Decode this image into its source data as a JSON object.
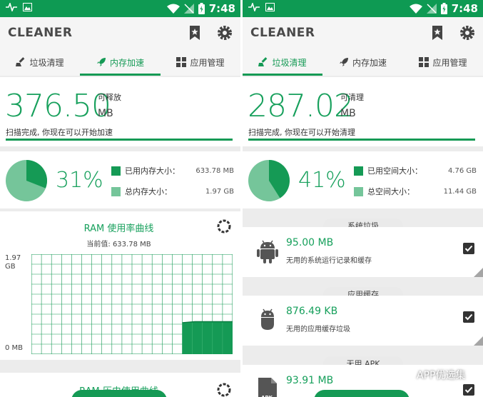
{
  "colors": {
    "brand": "#159a55",
    "status_bar": "#0e9a53",
    "pie_light": "#75c59a",
    "pie_dark": "#159a55"
  },
  "status_bar": {
    "time": "7:48"
  },
  "app": {
    "title": "CLEANER"
  },
  "tabs": [
    {
      "label": "垃圾清理",
      "icon": "broom-icon"
    },
    {
      "label": "内存加速",
      "icon": "rocket-icon"
    },
    {
      "label": "应用管理",
      "icon": "apps-grid-icon"
    }
  ],
  "memory_screen": {
    "active_tab": 1,
    "free": {
      "value": "376.50",
      "label": "可释放",
      "unit": "MB"
    },
    "scan_message": "扫描完成, 你现在可以开始加速",
    "usage": {
      "percent_text": "31%",
      "fraction": 0.31
    },
    "legend": [
      {
        "label": "已用内存大小：",
        "value": "633.78 MB"
      },
      {
        "label": "总内存大小：",
        "value": "1.97 GB"
      }
    ],
    "ram_chart": {
      "title": "RAM 使用率曲线",
      "current_label": "当前值: 633.78 MB",
      "y_max_label": "1.97\nGB",
      "y_min_label": "0 MB"
    },
    "history_title": "RAM 历史使用曲线"
  },
  "junk_screen": {
    "active_tab": 0,
    "cleanable": {
      "value": "287.02",
      "label": "可清理",
      "unit": "MB"
    },
    "scan_message": "扫描完成, 你现在可以开始清理",
    "usage": {
      "percent_text": "41%",
      "fraction": 0.41
    },
    "legend": [
      {
        "label": "已用空间大小：",
        "value": "4.76 GB"
      },
      {
        "label": "总空间大小：",
        "value": "11.44 GB"
      }
    ],
    "groups": [
      {
        "header": "系统垃圾",
        "size": "95.00 MB",
        "description": "无用的系统运行记录和缓存",
        "icon": "android-icon",
        "checked": true
      },
      {
        "header": "应用缓存",
        "size": "876.49 KB",
        "description": "无用的应用缓存垃圾",
        "icon": "android-icon",
        "checked": true
      },
      {
        "header": "无用 APK",
        "size": "93.91 MB",
        "description": "",
        "icon": "apk-file-icon",
        "checked": true
      }
    ]
  },
  "watermark": {
    "text": "APP优选集"
  },
  "chart_data": {
    "type": "area",
    "title": "RAM 使用率曲线",
    "xlabel": "",
    "ylabel": "",
    "y_tick_labels": [
      "0 MB",
      "1.97 GB"
    ],
    "ylim": [
      0,
      1.97
    ],
    "y_unit": "GB",
    "current_value": "633.78 MB",
    "series": [
      {
        "values": [
          0.62,
          0.64,
          0.64,
          0.64,
          0.64
        ]
      }
    ]
  }
}
